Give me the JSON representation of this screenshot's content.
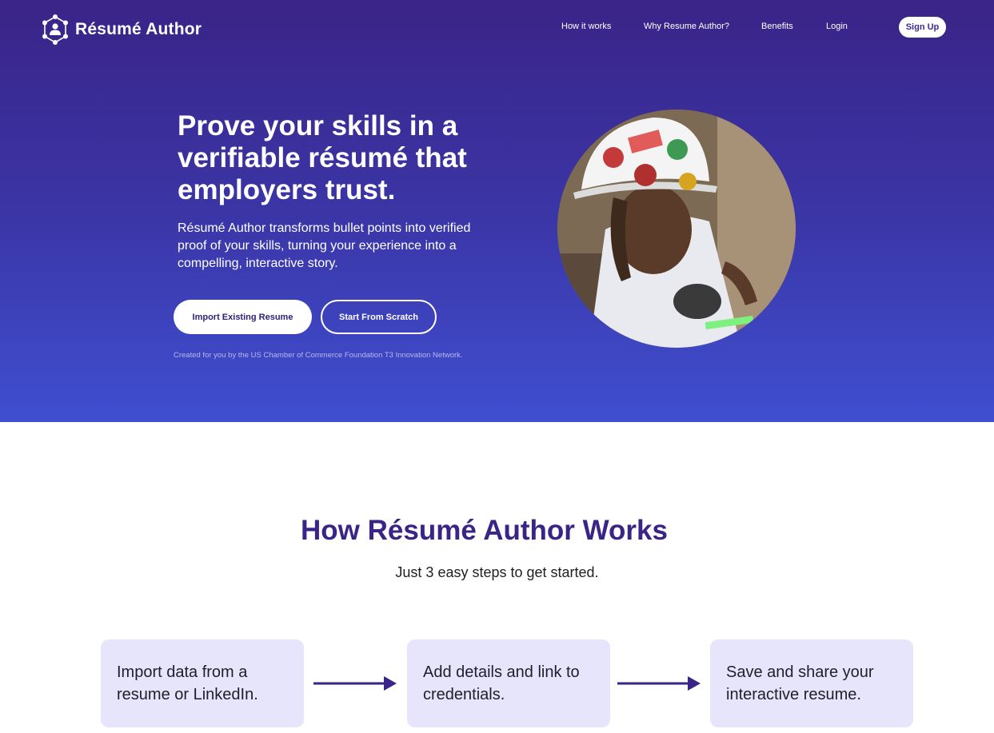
{
  "nav": {
    "brand": "Résumé Author",
    "links": [
      "How it works",
      "Why Resume Author?",
      "Benefits",
      "Login"
    ],
    "signup": "Sign Up"
  },
  "hero": {
    "headline": "Prove your skills in a verifiable résumé that employers trust.",
    "subtext": "Résumé Author transforms bullet points into verified proof of your skills, turning your experience into a compelling, interactive story.",
    "import_button": "Import Existing Resume",
    "scratch_button": "Start From Scratch",
    "credit": "Created for you by the US Chamber of Commerce Foundation T3 Innovation Network."
  },
  "how": {
    "title": "How Résumé Author Works",
    "subtitle": "Just 3 easy steps to get started.",
    "steps": [
      "Import data from a resume or LinkedIn.",
      "Add details and link to credentials.",
      "Save and share your interactive resume."
    ]
  },
  "colors": {
    "hero_top": "#3a2487",
    "hero_bottom": "#3f4fd0",
    "accent": "#3a2487",
    "step_bg": "#e6e5fb"
  },
  "icons": [
    "resume-author-logo-icon",
    "arrow-right-icon"
  ]
}
